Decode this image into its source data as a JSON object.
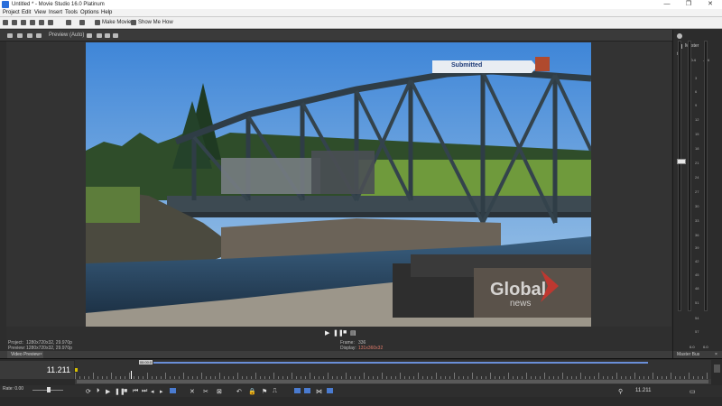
{
  "window": {
    "title": "Untitled * - Movie Studio 16.0 Platinum",
    "minimize": "—",
    "maximize": "❐",
    "close": "✕"
  },
  "menu": {
    "items": [
      "Project",
      "Edit",
      "View",
      "Insert",
      "Tools",
      "Options",
      "Help"
    ]
  },
  "toolbar": {
    "make_movie": "Make Movie",
    "show_me_how": "Show Me How"
  },
  "preview_toolbar": {
    "quality": "Preview (Auto)"
  },
  "video": {
    "overlay_label": "Submitted",
    "watermark": "Global",
    "watermark_sub": "news"
  },
  "preview_info": {
    "project_label": "Project:",
    "project_value": "1280x720x32, 29.970p",
    "preview_label": "Preview:",
    "preview_value": "1280x720x32, 29.970p",
    "frame_label": "Frame:",
    "frame_value": "336",
    "display_label": "Display:",
    "display_value": "131x360x32"
  },
  "tabs": {
    "video_preview": "Video Preview",
    "master_bus": "Master Bus",
    "close_x": "×"
  },
  "master": {
    "label": "Master",
    "left_top": "-0.4",
    "right_top": "-0.4",
    "bottom_left": "0.0",
    "bottom_right": "0.0",
    "db_scale": [
      "3",
      "6",
      "9",
      "12",
      "15",
      "18",
      "21",
      "24",
      "27",
      "30",
      "33",
      "36",
      "39",
      "42",
      "45",
      "48",
      "51",
      "54",
      "57"
    ]
  },
  "timeline": {
    "current_time": "11.211",
    "marker_label": "00:00:0",
    "rate_label": "Rate: 0.00",
    "status_time": "11.211"
  },
  "colors": {
    "accent": "#4a7bd0",
    "region": "#6a8fd8",
    "marker": "#d8c000"
  }
}
